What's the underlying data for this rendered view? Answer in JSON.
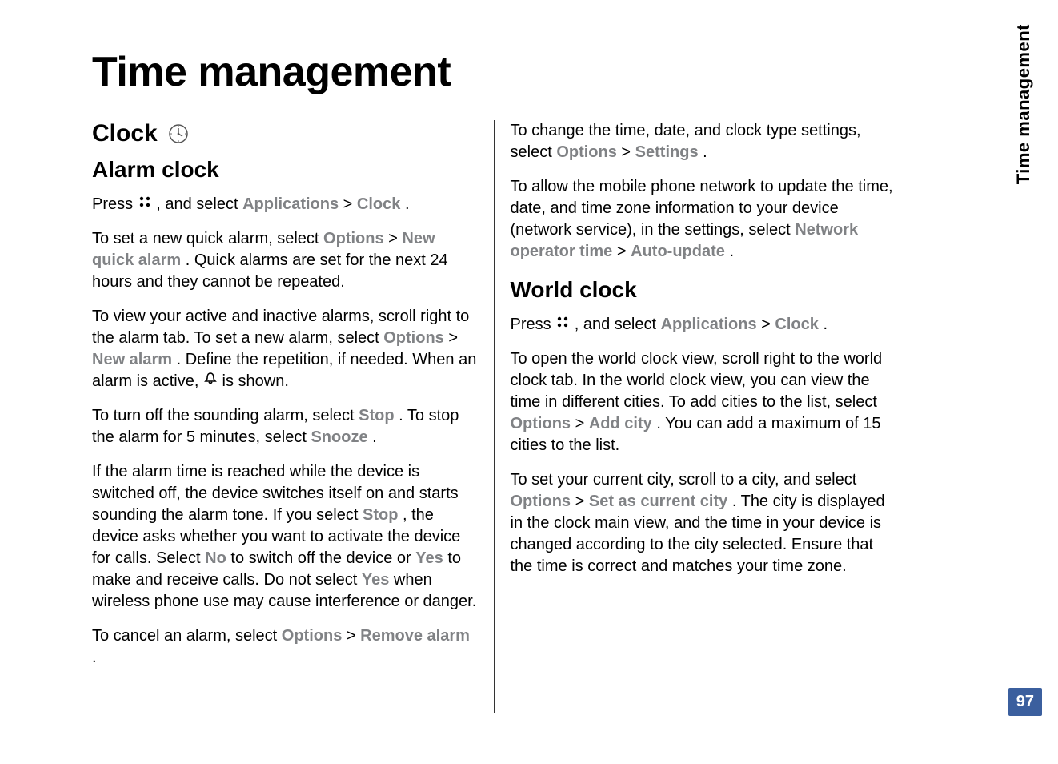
{
  "page": {
    "chapter_title": "Time management",
    "side_tab": "Time management",
    "page_number": "97"
  },
  "section_clock": {
    "title": "Clock"
  },
  "alarm_clock": {
    "title": "Alarm clock",
    "p1_a": "Press ",
    "p1_b": " , and select ",
    "p1_applications": "Applications",
    "p1_sep": " > ",
    "p1_clock": "Clock",
    "p1_dot": ".",
    "p2_a": "To set a new quick alarm, select ",
    "p2_options": "Options",
    "p2_sep": " > ",
    "p2_new_quick_alarm": "New quick alarm",
    "p2_b": ". Quick alarms are set for the next 24 hours and they cannot be repeated.",
    "p3_a": "To view your active and inactive alarms, scroll right to the alarm tab. To set a new alarm, select ",
    "p3_options": "Options",
    "p3_sep": " > ",
    "p3_new_alarm": "New alarm",
    "p3_b": ". Define the repetition, if needed. When an alarm is active, ",
    "p3_c": " is shown.",
    "p4_a": "To turn off the sounding alarm, select ",
    "p4_stop": "Stop",
    "p4_b": ". To stop the alarm for 5 minutes, select ",
    "p4_snooze": "Snooze",
    "p4_dot": ".",
    "p5_a": "If the alarm time is reached while the device is switched off, the device switches itself on and starts sounding the alarm tone. If you select ",
    "p5_stop": "Stop",
    "p5_b": ", the device asks whether you want to activate the device for calls. Select ",
    "p5_no": "No",
    "p5_c": " to switch off the device or ",
    "p5_yes": "Yes",
    "p5_d": " to make and receive calls. Do not select ",
    "p5_yes2": "Yes",
    "p5_e": " when wireless phone use may cause interference or danger.",
    "p6_a": "To cancel an alarm, select ",
    "p6_options": "Options",
    "p6_sep": " > ",
    "p6_remove_alarm": "Remove alarm",
    "p6_dot": ".",
    "p7_a": "To change the time, date, and clock type settings, select ",
    "p7_options": "Options",
    "p7_sep": " > ",
    "p7_settings": "Settings",
    "p7_dot": ".",
    "p8_a": "To allow the mobile phone network to update the time, date, and time zone information to your device (network service), in the settings, select ",
    "p8_not": "Network operator time",
    "p8_sep": " > ",
    "p8_auto_update": "Auto-update",
    "p8_dot": "."
  },
  "world_clock": {
    "title": "World clock",
    "p1_a": "Press ",
    "p1_b": ", and select ",
    "p1_applications": "Applications",
    "p1_sep": " > ",
    "p1_clock": "Clock",
    "p1_dot": ".",
    "p2_a": "To open the world clock view, scroll right to the world clock tab. In the world clock view, you can view the time in different cities. To add cities to the list, select ",
    "p2_options": "Options",
    "p2_sep": " > ",
    "p2_add_city": "Add city",
    "p2_b": ". You can add a maximum of 15 cities to the list.",
    "p3_a": "To set your current city, scroll to a city, and select ",
    "p3_options": "Options",
    "p3_sep": " > ",
    "p3_set_city": "Set as current city",
    "p3_b": ". The city is displayed in the clock main view, and the time in your device is changed according to the city selected. Ensure that the time is correct and matches your time zone."
  }
}
